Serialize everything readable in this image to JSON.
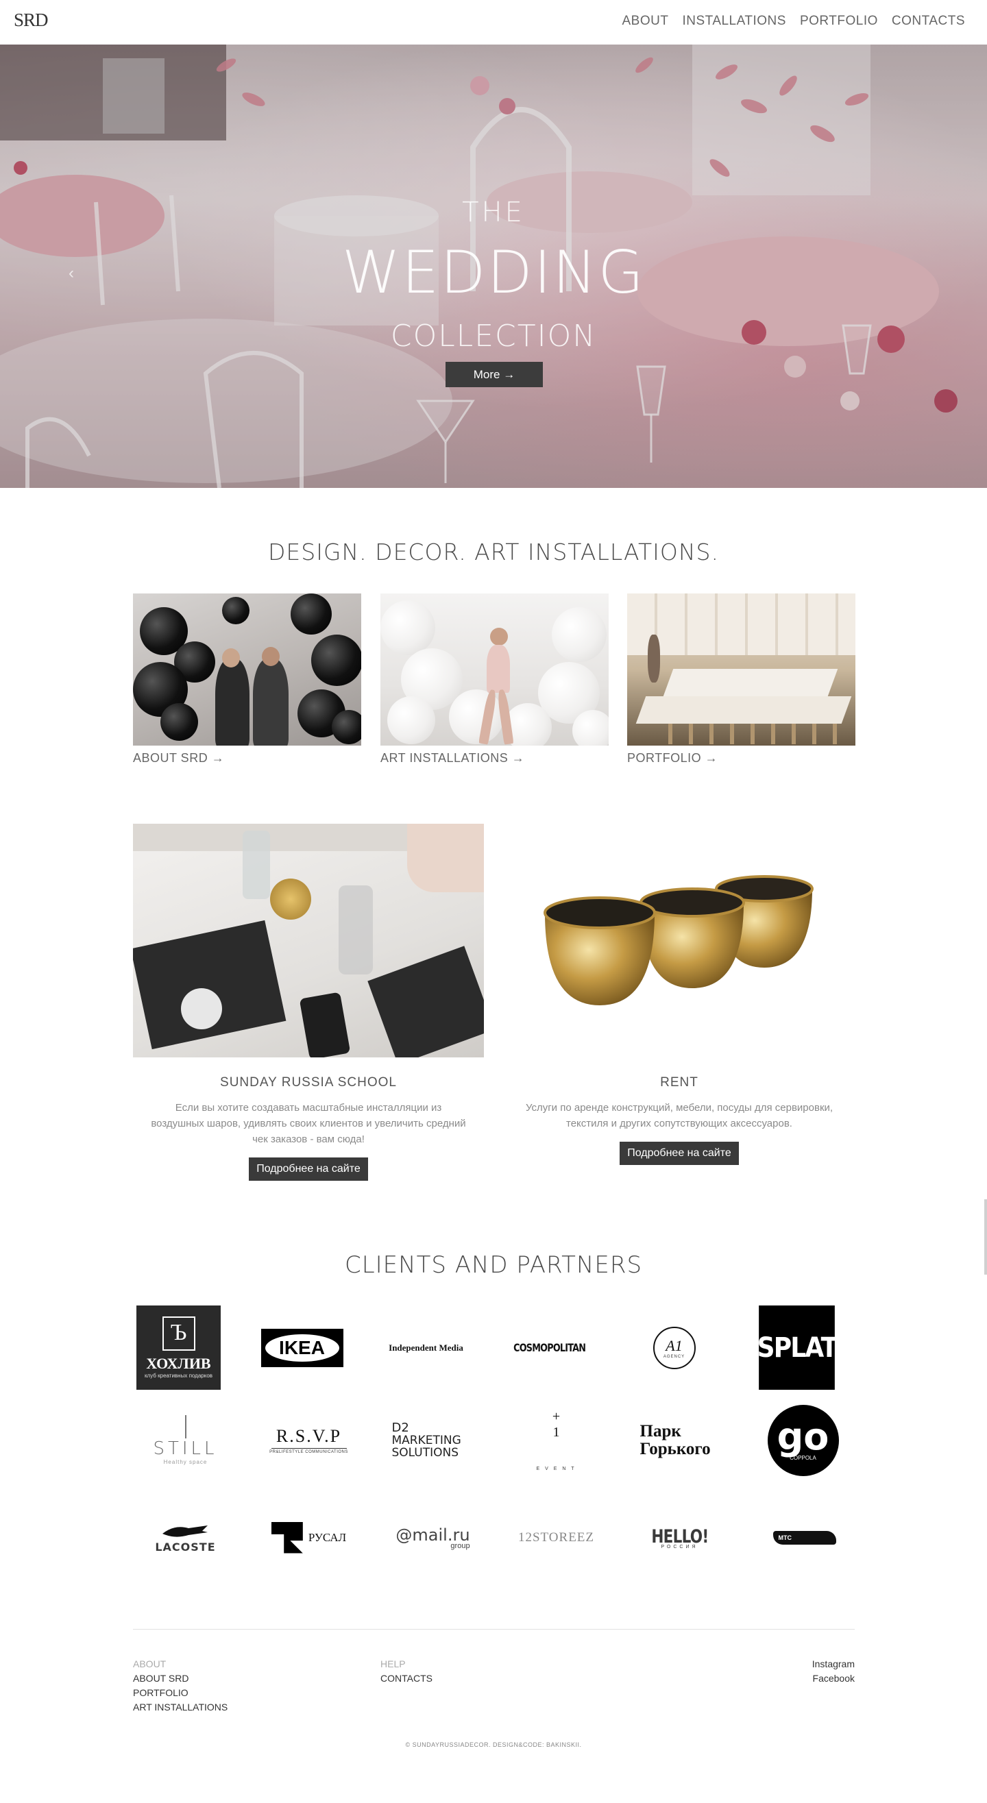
{
  "header": {
    "logo": "SRD",
    "nav": [
      "ABOUT",
      "INSTALLATIONS",
      "PORTFOLIO",
      "CONTACTS"
    ]
  },
  "hero": {
    "line1": "THE",
    "line2": "WEDDING",
    "line3": "COLLECTION",
    "button": "More →"
  },
  "intro": {
    "title": "DESIGN. DECOR. ART INSTALLATIONS.",
    "cards": [
      {
        "label": "ABOUT SRD →"
      },
      {
        "label": "ART INSTALLATIONS →"
      },
      {
        "label": "PORTFOLIO →"
      }
    ]
  },
  "services": [
    {
      "title": "SUNDAY RUSSIA SCHOOL",
      "text": "Если вы хотите создавать масштабные инсталляции из воздушных шаров, удивлять своих клиентов и увеличить средний чек заказов - вам сюда!",
      "button": "Подробнее на сайте"
    },
    {
      "title": "RENT",
      "text": "Услуги по аренде конструкций, мебели, посуды для сервировки, текстиля и других сопутствующих аксессуаров.",
      "button": "Подробнее на сайте"
    }
  ],
  "clients": {
    "title": "CLIENTS AND PARTNERS",
    "logos": [
      {
        "name": "ХОХЛИВ",
        "sub": "клуб креативных подарков"
      },
      {
        "name": "IKEA"
      },
      {
        "name": "Independent Media"
      },
      {
        "name": "COSMOPOLITAN"
      },
      {
        "name": "A1",
        "sub": "AGENCY"
      },
      {
        "name": "SPLAT"
      },
      {
        "name": "STILL",
        "sub": "Healthy space"
      },
      {
        "name": "R.S.V.P",
        "sub": "PR&LIFESTYLE COMMUNICATIONS"
      },
      {
        "name": "D2",
        "sub": "MARKETING SOLUTIONS"
      },
      {
        "name": "+ 1",
        "sub": "E V E N T"
      },
      {
        "name": "Парк Горького"
      },
      {
        "name": "go",
        "sub": "COPPOLA"
      },
      {
        "name": "LACOSTE"
      },
      {
        "name": "РУСАЛ"
      },
      {
        "name": "@mail.ru",
        "sub": "group"
      },
      {
        "name": "12STOREEZ"
      },
      {
        "name": "HELLO!",
        "sub": "РОССИЯ"
      },
      {
        "name": "МТС"
      }
    ]
  },
  "footer": {
    "col1": {
      "heading": "ABOUT",
      "links": [
        "ABOUT SRD",
        "PORTFOLIO",
        "ART INSTALLATIONS"
      ]
    },
    "col2": {
      "heading": "HELP",
      "links": [
        "CONTACTS"
      ]
    },
    "col3": {
      "links": [
        "Instagram",
        "Facebook"
      ]
    },
    "copyright": "© SUNDAYRUSSIADECOR. DESIGN&CODE: BAKINSKII."
  },
  "colors": {
    "button_bg": "#3a3a3a",
    "text_muted": "#8a8a8a",
    "hero_pink": "#e6a0ad"
  }
}
